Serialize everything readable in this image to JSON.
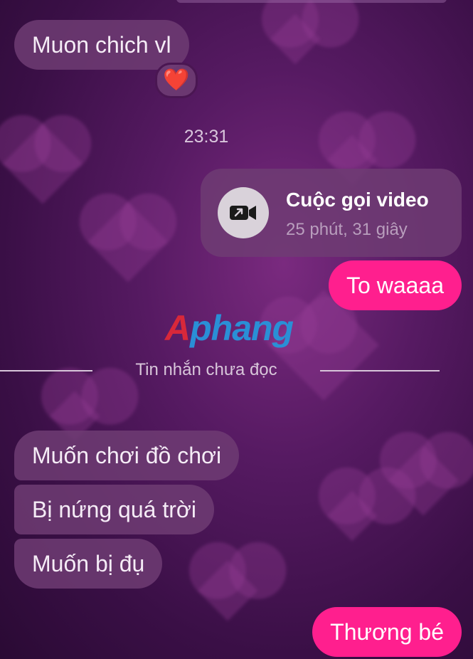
{
  "messages": {
    "first_incoming": "Muon chich vl",
    "reaction_emoji": "❤️",
    "timestamp": "23:31",
    "call": {
      "icon": "video-call-icon",
      "title": "Cuộc gọi video",
      "duration": "25 phút, 31 giây"
    },
    "outgoing_1": "To waaaa",
    "unread_divider": "Tin nhắn chưa đọc",
    "incoming_group": [
      "Muốn chơi đồ chơi",
      "Bị nứng quá trời",
      "Muốn bị đụ"
    ],
    "outgoing_2": "Thương bé"
  },
  "watermark": {
    "first_letter": "A",
    "rest": "phang"
  },
  "colors": {
    "outgoing_bubble": "#ff1f8e",
    "incoming_bubble": "#6e3c73",
    "background": "#561a62"
  }
}
